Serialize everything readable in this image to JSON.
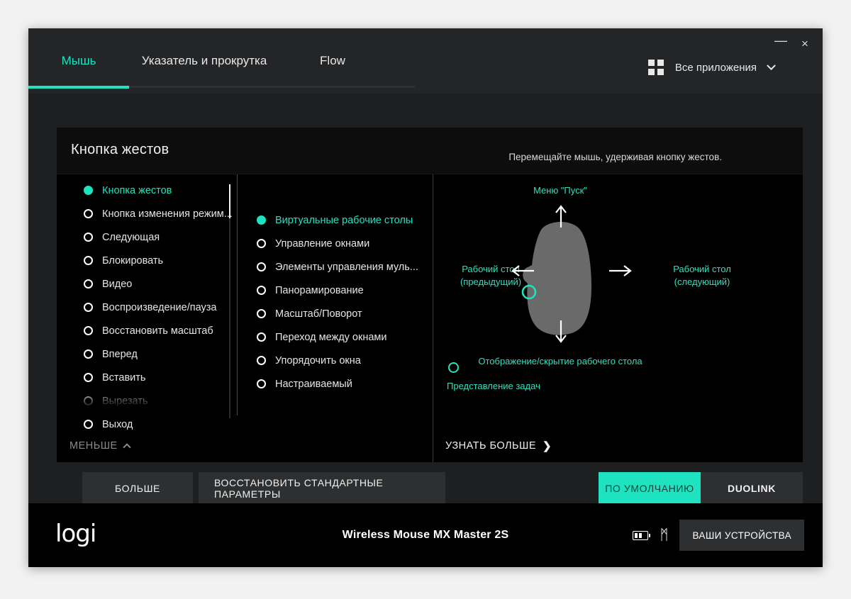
{
  "window": {
    "minimize_label": "—",
    "close_label": "×",
    "accent_color": "#1fe3c0",
    "background_color": "#1e1f21"
  },
  "tabs": [
    {
      "label": "Мышь",
      "active": true
    },
    {
      "label": "Указатель и прокрутка",
      "active": false
    },
    {
      "label": "Flow",
      "active": false
    }
  ],
  "apps_selector": {
    "label": "Все приложения",
    "grid_icon": "grid-icon",
    "chevron_icon": "chevron-down-icon"
  },
  "card": {
    "title": "Кнопка жестов",
    "hint": "Перемещайте мышь, удерживая кнопку жестов."
  },
  "left_list": {
    "items": [
      {
        "label": "Кнопка жестов",
        "selected": true
      },
      {
        "label": "Кнопка изменения режим...",
        "selected": false
      },
      {
        "label": "Следующая",
        "selected": false
      },
      {
        "label": "Блокировать",
        "selected": false
      },
      {
        "label": "Видео",
        "selected": false
      },
      {
        "label": "Воспроизведение/пауза",
        "selected": false
      },
      {
        "label": "Восстановить масштаб",
        "selected": false
      },
      {
        "label": "Вперед",
        "selected": false
      },
      {
        "label": "Вставить",
        "selected": false
      },
      {
        "label": "Вырезать",
        "selected": false
      },
      {
        "label": "Выход",
        "selected": false
      }
    ],
    "collapse_label": "МЕНЬШЕ"
  },
  "mid_list": {
    "items": [
      {
        "label": "Виртуальные рабочие столы",
        "selected": true
      },
      {
        "label": "Управление окнами",
        "selected": false
      },
      {
        "label": "Элементы управления муль...",
        "selected": false
      },
      {
        "label": "Панорамирование",
        "selected": false
      },
      {
        "label": "Масштаб/Поворот",
        "selected": false
      },
      {
        "label": "Переход между окнами",
        "selected": false
      },
      {
        "label": "Упорядочить окна",
        "selected": false
      },
      {
        "label": "Настраиваемый",
        "selected": false
      }
    ]
  },
  "diagram": {
    "learn_more_label": "УЗНАТЬ БОЛЬШЕ",
    "label_up": "Меню \"Пуск\"",
    "label_left": "Рабочий стол\n(предыдущий)",
    "label_left_line1": "Рабочий стол",
    "label_left_line2": "(предыдущий)",
    "label_right_line1": "Рабочий стол",
    "label_right_line2": "(следующий)",
    "label_down": "Отображение/скрытие рабочего стола",
    "label_task": "Представление задач",
    "label_color": "#2fe0bf",
    "mouse_color": "#6a6a6a"
  },
  "buttons": {
    "more": "БОЛЬШЕ",
    "restore_defaults": "ВОССТАНОВИТЬ СТАНДАРТНЫЕ ПАРАМЕТРЫ",
    "default_profile": "ПО УМОЛЧАНИЮ",
    "duolink_profile": "DUOLINK"
  },
  "footer": {
    "brand": "logi",
    "device_name": "Wireless Mouse MX Master 2S",
    "battery_icon": "battery-icon",
    "bluetooth_icon": "bluetooth-icon",
    "bluetooth_glyph": "ᛗ",
    "your_devices_label": "ВАШИ УСТРОЙСТВА"
  }
}
